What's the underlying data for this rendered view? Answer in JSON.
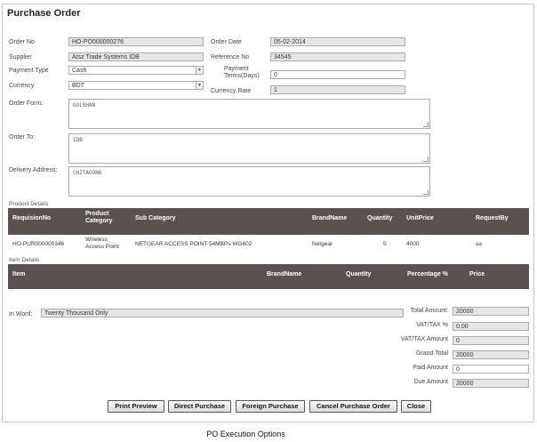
{
  "page_title": "Purchase Order",
  "header_fields": {
    "order_no": {
      "label": "Order No",
      "value": "HO-PO000000276"
    },
    "supplier": {
      "label": "Supplier",
      "value": "Atsz Trade Systems IDB"
    },
    "payment_type": {
      "label": "Payment Type",
      "value": "Cash"
    },
    "currency": {
      "label": "Currency",
      "value": "BDT"
    },
    "order_date": {
      "label": "Order Date",
      "value": "05-02-2014"
    },
    "reference_no": {
      "label": "Reference No",
      "value": "34545"
    },
    "payment_terms": {
      "label_line1": "Payment",
      "label_line2": "Terms(Days)",
      "value": "0"
    },
    "currency_rate": {
      "label": "Currency Rate",
      "value": "1"
    }
  },
  "addresses": {
    "order_form": {
      "label": "Order Form:",
      "value": "GULSHAN"
    },
    "order_to": {
      "label": "Order To:",
      "value": "IDB"
    },
    "delivery_address": {
      "label": "Delivery Address:",
      "value": "CHITAGONG"
    }
  },
  "product_details": {
    "section_label": "Product Details",
    "columns": [
      "RequisionNo",
      "Product Category",
      "Sub Category",
      "BrandName",
      "Quantity",
      "UnitPrice",
      "RequestBy"
    ],
    "rows": [
      {
        "requisition_no": "HO-PUR000000346",
        "category_line1": "Wireless",
        "category_line2": "Access Point",
        "sub_category": "NETGEAR ACCESS POINT 54MBPs WG602",
        "brand": "Netgear",
        "quantity": "5",
        "unit_price": "4000",
        "request_by": "sa"
      }
    ]
  },
  "item_details": {
    "section_label": "Item Details",
    "columns": [
      "Item",
      "BrandName",
      "Quantity",
      "Percentage %",
      "Price"
    ]
  },
  "in_word": {
    "label": "In Word:",
    "value": "Twenty Thousand Only"
  },
  "summary": [
    {
      "label": "Total Amount:",
      "value": "20000"
    },
    {
      "label": "VAT/TAX %",
      "value": "0.00"
    },
    {
      "label": "VAT/TAX Amount",
      "value": "0"
    },
    {
      "label": "Grand Total",
      "value": "20000"
    },
    {
      "label": "Paid Amount",
      "value": "0"
    },
    {
      "label": "Due Amount",
      "value": "20000"
    }
  ],
  "buttons": {
    "print_preview": "Print Preview",
    "direct_purchase": "Direct Purchase",
    "foreign_purchase": "Foreign Purchase",
    "cancel_purchase_order": "Cancel Purchase Order",
    "close": "Close"
  },
  "caption": "PO Execution Options"
}
